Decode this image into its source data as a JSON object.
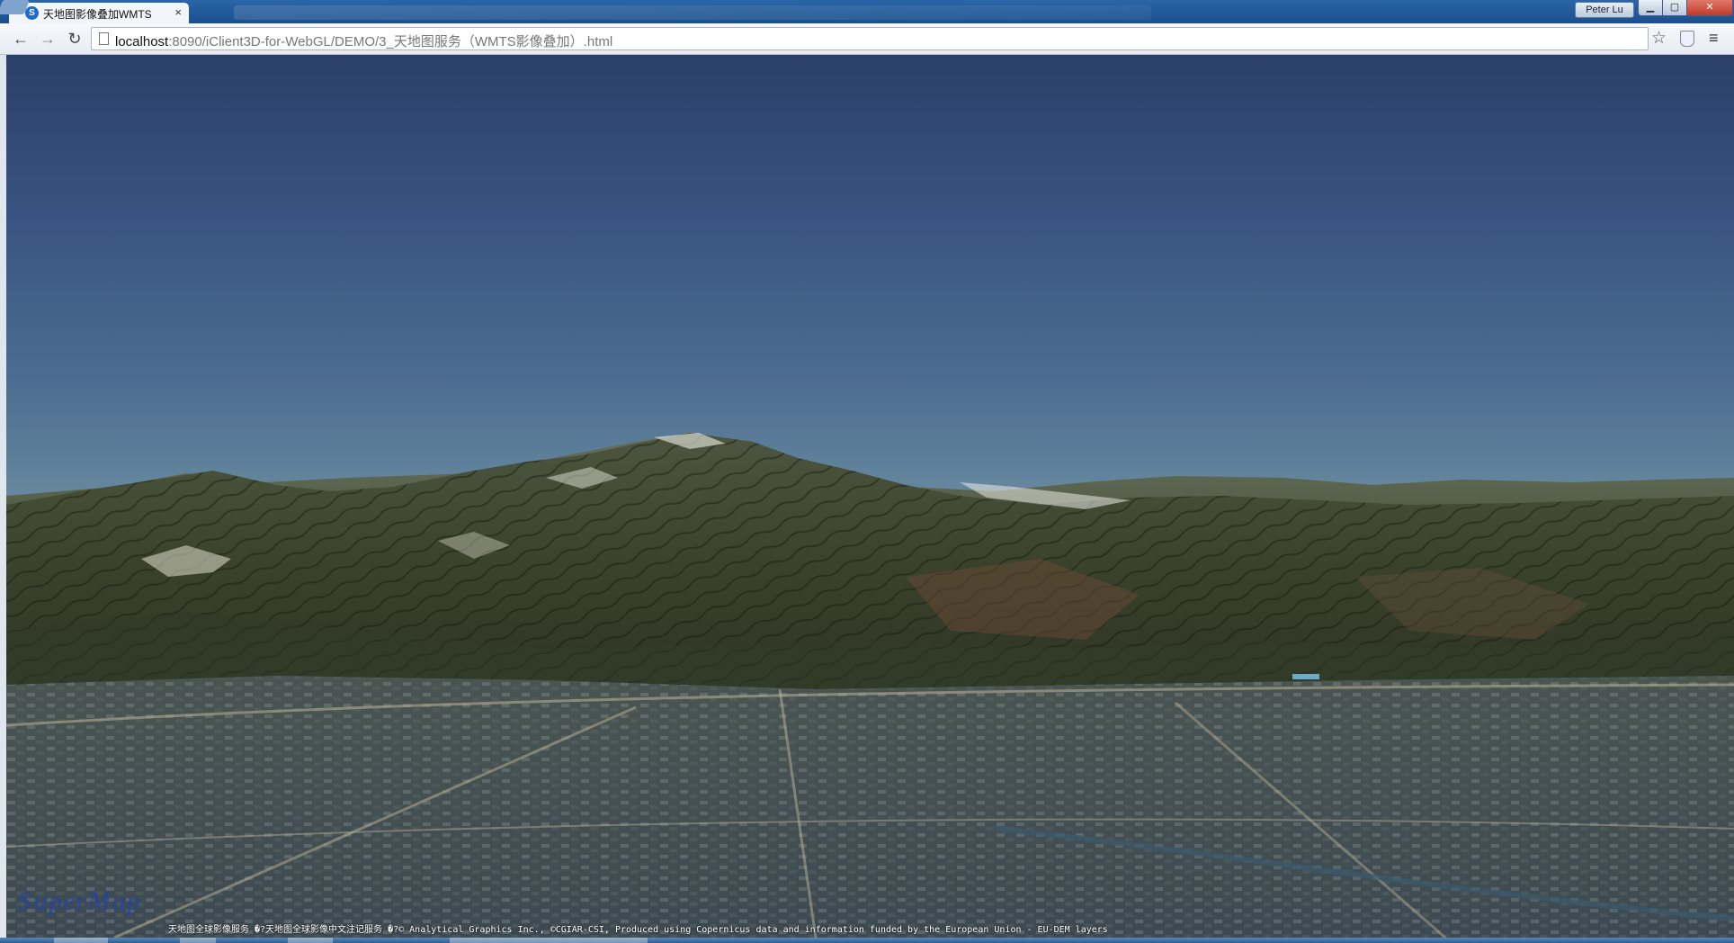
{
  "browser": {
    "tab_title": "天地图影像叠加WMTS",
    "tab_close_glyph": "×",
    "user_name": "Peter Lu",
    "url_host": "localhost",
    "url_rest": ":8090/iClient3D-for-WebGL/DEMO/3_天地图服务（WMTS影像叠加）.html",
    "icons": {
      "back": "back-arrow-icon",
      "forward": "forward-arrow-icon",
      "reload": "reload-icon",
      "bookmark": "star-icon",
      "menu": "hamburger-menu-icon"
    }
  },
  "viewer": {
    "logo_text": "SuperMap",
    "credits": "天地图全球影像服务 �?天地图全球影像中文注记服务 �?© Analytical Graphics Inc., ©CGIAR-CSI, Produced using Copernicus data and information funded by the European Union - EU-DEM layers",
    "colors": {
      "sky_top": "#2b3f6a",
      "sky_horizon": "#a9bdb1",
      "terrain_dark": "#2f3a24",
      "terrain_light": "#5b6244"
    }
  }
}
